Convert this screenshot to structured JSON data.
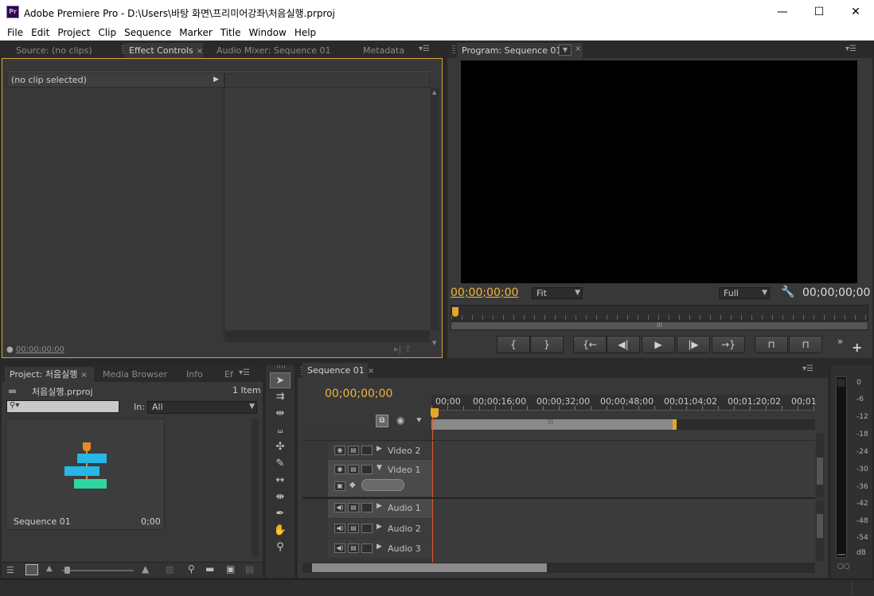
{
  "window": {
    "title": "Adobe Premiere Pro - D:\\Users\\바탕 화면\\프리미어강좌\\처음실행.prproj",
    "app_icon_text": "Pr",
    "minimize": "—",
    "maximize": "☐",
    "close": "✕"
  },
  "menu": [
    "File",
    "Edit",
    "Project",
    "Clip",
    "Sequence",
    "Marker",
    "Title",
    "Window",
    "Help"
  ],
  "source_panel": {
    "tabs": [
      "Source: (no clips)",
      "Effect Controls",
      "Audio Mixer: Sequence 01",
      "Metadata"
    ],
    "active_tab": "Effect Controls",
    "clip_header": "(no clip selected)",
    "timecode": "00;00;00;00"
  },
  "program_panel": {
    "tab": "Program: Sequence 01",
    "timecode_left": "00;00;00;00",
    "timecode_right": "00;00;00;00",
    "zoom": "Fit",
    "quality": "Full",
    "transport": [
      "{",
      "}",
      "{←",
      "◀|",
      "▶",
      "|▶",
      "→}",
      "⊓",
      "⊓"
    ],
    "more": "»",
    "add": "+"
  },
  "project_panel": {
    "tabs": [
      "Project: 처음실행",
      "Media Browser",
      "Info",
      "Ef"
    ],
    "file_name": "처음실행.prproj",
    "item_count": "1 Item",
    "in_label": "In:",
    "in_value": "All",
    "sequence_name": "Sequence 01",
    "sequence_duration": "0;00",
    "thumb_colors": [
      "#27b6e6",
      "#27b6e6",
      "#2fd5a0"
    ]
  },
  "timeline": {
    "tab": "Sequence 01",
    "timecode": "00;00;00;00",
    "ruler": [
      "00;00",
      "00;00;16;00",
      "00;00;32;00",
      "00;00;48;00",
      "00;01;04;02",
      "00;01;20;02",
      "00;01"
    ],
    "tracks": [
      {
        "name": "Video 2",
        "kind": "video"
      },
      {
        "name": "Video 1",
        "kind": "video"
      },
      {
        "name": "Audio 1",
        "kind": "audio"
      },
      {
        "name": "Audio 2",
        "kind": "audio"
      },
      {
        "name": "Audio 3",
        "kind": "audio"
      }
    ]
  },
  "audio_meter": {
    "labels": [
      "0",
      "-6",
      "-12",
      "-18",
      "-24",
      "-30",
      "-36",
      "-42",
      "-48",
      "-54",
      "dB"
    ]
  },
  "tools": [
    "selection-tool",
    "track-select-tool",
    "ripple-edit-tool",
    "rolling-edit-tool",
    "rate-stretch-tool",
    "razor-tool",
    "slip-tool",
    "slide-tool",
    "pen-tool",
    "hand-tool",
    "zoom-tool"
  ]
}
